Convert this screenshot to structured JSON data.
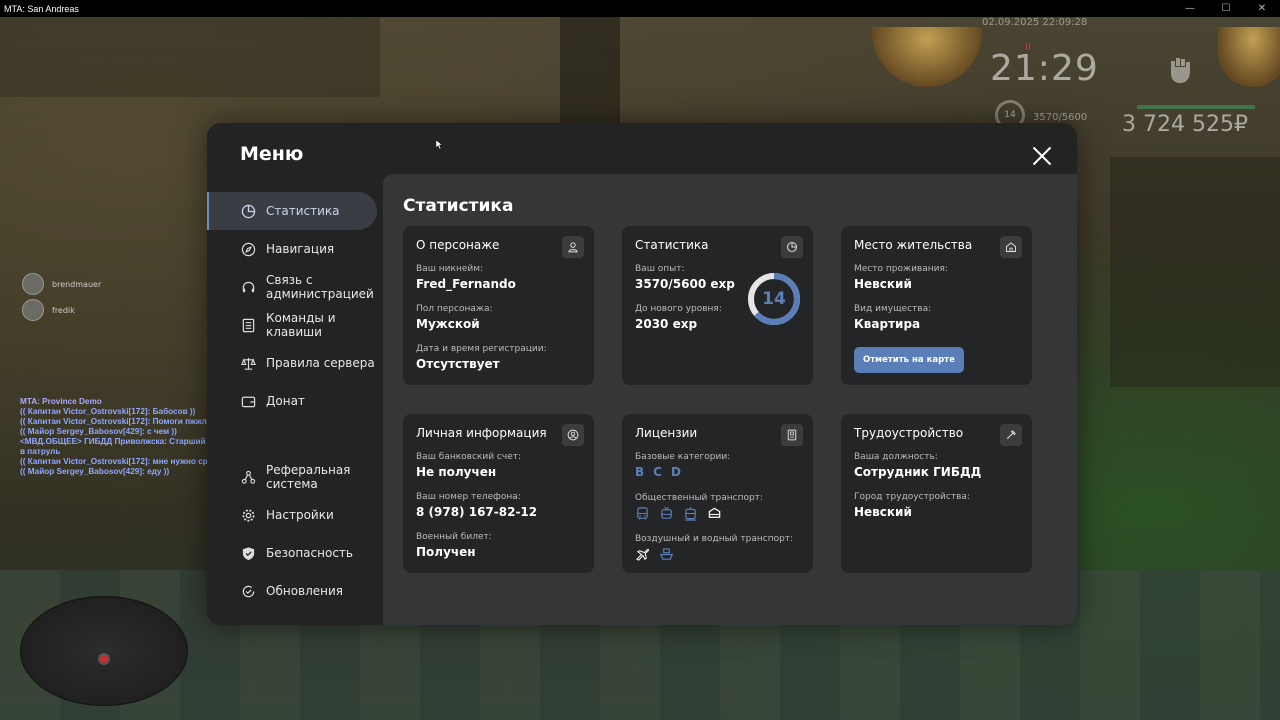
{
  "window": {
    "title": "MTA: San Andreas",
    "controls": [
      "—",
      "☐",
      "✕"
    ]
  },
  "hud": {
    "date": "02.09.2025 22:09:28",
    "time": "21:29",
    "money": "3 724 525₽",
    "level": "14",
    "exp": "3570/5600",
    "status_marker": "II"
  },
  "voice": [
    {
      "name": "brendmauer"
    },
    {
      "name": "fredik"
    }
  ],
  "chat": [
    "MTA: Province Demo",
    "(( Капитан Victor_Ostrovski[172]: Бабосов ))",
    "(( Капитан Victor_Ostrovski[172]: Помоги пжжлжлтж ))",
    "(( Майор Sergey_Babosov[429]: с чем ))",
    "<МВД.ОБЩЕЕ> ГИБДД Приволжска: Старший лейтенант Igor_Griff[234]: Ушёл гоу",
    " в патруль",
    "(( Капитан Victor_Ostrovski[172]: мне нужно срочно 1кк иначе на 30 к улечу ))",
    "(( Майор Sergey_Babosov[429]: еду ))"
  ],
  "menu": {
    "title": "Меню",
    "sidebar": [
      {
        "label": "Статистика",
        "icon": "pie-chart-icon"
      },
      {
        "label": "Навигация",
        "icon": "compass-icon"
      },
      {
        "label": "Связь с администрацией",
        "icon": "headset-icon"
      },
      {
        "label": "Команды и клавиши",
        "icon": "keyboard-icon"
      },
      {
        "label": "Правила сервера",
        "icon": "scales-icon"
      },
      {
        "label": "Донат",
        "icon": "wallet-icon"
      },
      {
        "label": "",
        "icon": "blank-icon"
      },
      {
        "label": "Реферальная система",
        "icon": "share-icon"
      },
      {
        "label": "Настройки",
        "icon": "gear-icon"
      },
      {
        "label": "Безопасность",
        "icon": "shield-icon"
      },
      {
        "label": "Обновления",
        "icon": "update-icon"
      }
    ],
    "content_title": "Статистика",
    "cards": {
      "character": {
        "title": "О персонаже",
        "nick_label": "Ваш никнейм:",
        "nick": "Fred_Fernando",
        "sex_label": "Пол персонажа:",
        "sex": "Мужской",
        "reg_label": "Дата и время регистрации:",
        "reg": "Отсутствует"
      },
      "stats": {
        "title": "Статистика",
        "exp_label": "Ваш опыт:",
        "exp": "3570/5600 exp",
        "next_label": "До нового уровня:",
        "next": "2030 exp",
        "level": "14",
        "progress": 0.6375
      },
      "residence": {
        "title": "Место жительства",
        "place_label": "Место проживания:",
        "place": "Невский",
        "type_label": "Вид имущества:",
        "type": "Квартира",
        "button": "Отметить на карте"
      },
      "personal": {
        "title": "Личная информация",
        "bank_label": "Ваш банковский счет:",
        "bank": "Не получен",
        "phone_label": "Ваш номер телефона:",
        "phone": "8 (978) 167-82-12",
        "military_label": "Военный билет:",
        "military": "Получен"
      },
      "licenses": {
        "title": "Лицензии",
        "base_label": "Базовые категории:",
        "categories": [
          "B",
          "C",
          "D"
        ],
        "public_label": "Общественный транспорт:",
        "air_label": "Воздушный и водный транспорт:"
      },
      "job": {
        "title": "Трудоустройство",
        "position_label": "Ваша должность:",
        "position": "Сотрудник ГИБДД",
        "city_label": "Город трудоустройства:",
        "city": "Невский"
      }
    }
  },
  "colors": {
    "accent": "#5a7fb8",
    "panel": "#232323",
    "content": "#353637",
    "card": "#242526"
  }
}
